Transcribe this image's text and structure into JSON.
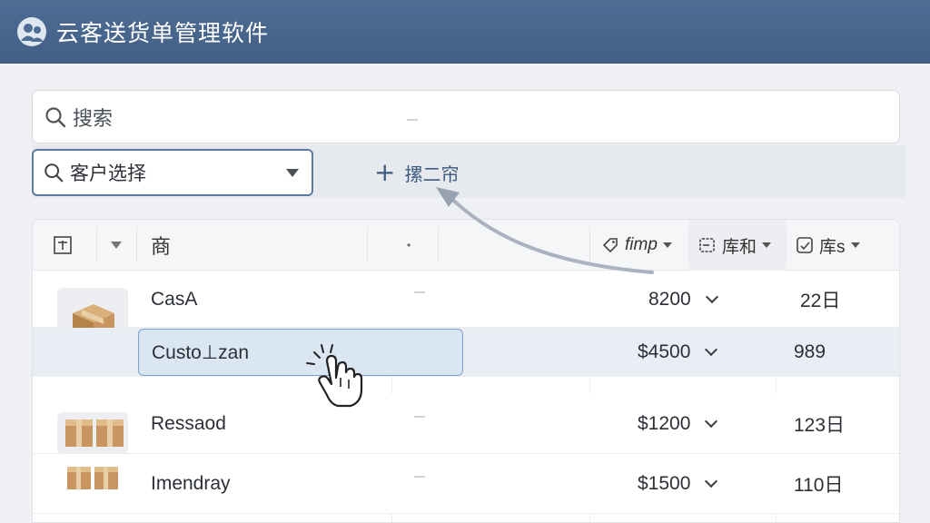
{
  "header": {
    "title": "云客送货单管理软件",
    "logo_icon": "users-icon",
    "bg_color": "#4a6890"
  },
  "search": {
    "placeholder": "搜索"
  },
  "toolbar": {
    "customer_select_label": "客户选择",
    "add_label": "摞二帘"
  },
  "table": {
    "columns": [
      {
        "label": "",
        "icon": "add-column-icon"
      },
      {
        "label": "",
        "icon": "chevron-down-icon"
      },
      {
        "label": "商"
      },
      {
        "label": "•"
      },
      {
        "label": "fimp",
        "icon": "tag-icon"
      },
      {
        "label": "库和",
        "icon": "document-icon"
      },
      {
        "label": "库s",
        "icon": "inspect-icon"
      }
    ],
    "rows": [
      {
        "name": "CasA",
        "price": "8200",
        "qty": "22日",
        "thumb": "box-icon"
      },
      {
        "name": "Custo⊥zan",
        "price": "$4500",
        "qty": "989",
        "thumb": ""
      },
      {
        "name": "Ressaod",
        "price": "$1200",
        "qty": "123日",
        "thumb": "boxes-icon"
      },
      {
        "name": "Imendray",
        "price": "$1500",
        "qty": "110日",
        "thumb": "boxes-icon"
      }
    ]
  },
  "accent_color": "#5d7aa0"
}
